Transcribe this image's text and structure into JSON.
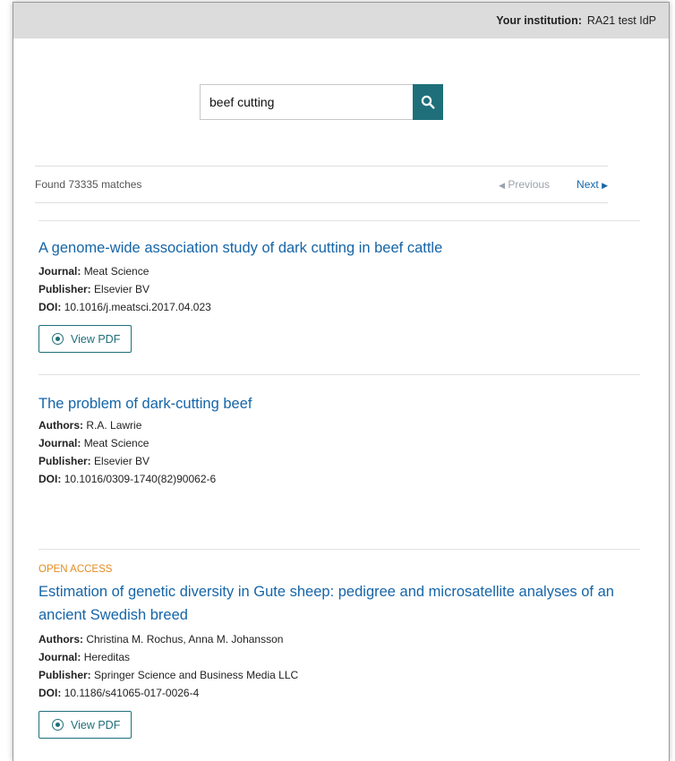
{
  "header": {
    "institution_label": "Your institution:",
    "institution_value": "RA21 test IdP"
  },
  "search": {
    "query": "beef cutting",
    "icon": "search-icon",
    "button_color": "#1e6f7a"
  },
  "results_bar": {
    "found_text": "Found 73335 matches",
    "previous_label": "Previous",
    "next_label": "Next"
  },
  "labels": {
    "authors": "Authors:",
    "journal": "Journal:",
    "publisher": "Publisher:",
    "doi": "DOI:",
    "view_pdf": "View PDF"
  },
  "results": [
    {
      "title": "A genome-wide association study of dark cutting in beef cattle",
      "journal": "Meat Science",
      "publisher": "Elsevier BV",
      "doi": "10.1016/j.meatsci.2017.04.023"
    },
    {
      "title": "The problem of dark-cutting beef",
      "authors": "R.A. Lawrie",
      "journal": "Meat Science",
      "publisher": "Elsevier BV",
      "doi": "10.1016/0309-1740(82)90062-6"
    },
    {
      "badge": "OPEN ACCESS",
      "title": "Estimation of genetic diversity in Gute sheep: pedigree and microsatellite analyses of an ancient Swedish breed",
      "authors": "Christina M. Rochus, Anna M. Johansson",
      "journal": "Hereditas",
      "publisher": "Springer Science and Business Media LLC",
      "doi": "10.1186/s41065-017-0026-4"
    }
  ],
  "colors": {
    "link": "#1565a8",
    "accent": "#1e6f7a",
    "open_access": "#e38c1f"
  }
}
